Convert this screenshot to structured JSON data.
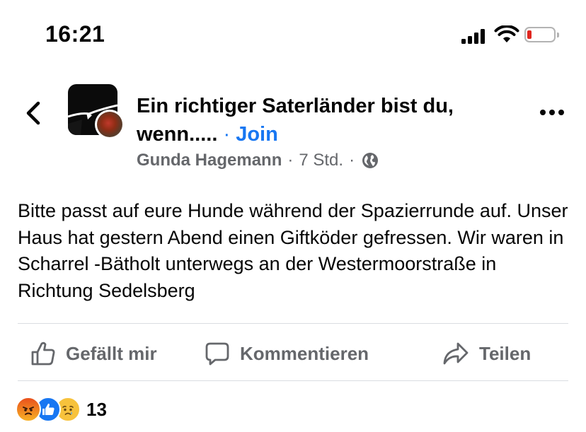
{
  "status_bar": {
    "time": "16:21"
  },
  "post": {
    "group_name": "Ein richtiger Saterländer bist du, wenn.....",
    "separator": "·",
    "join_label": "Join",
    "author": "Gunda Hagemann",
    "time_ago": "7 Std.",
    "meta_separator": "·",
    "text": "Bitte passt auf eure Hunde während der Spazierrunde auf. Unser Haus hat gestern Abend einen Giftköder gefressen. Wir waren in Scharrel -Bätholt unterwegs an der Westermoorstraße in Richtung Sedelsberg"
  },
  "actions": {
    "like_label": "Gefällt mir",
    "comment_label": "Kommentieren",
    "share_label": "Teilen"
  },
  "reactions": {
    "icons": [
      "angry-reaction-icon",
      "like-reaction-icon",
      "sad-reaction-icon"
    ],
    "count": "13"
  },
  "colors": {
    "link": "#1877f2",
    "secondary_text": "#65676b",
    "battery_low": "#e0261f"
  }
}
